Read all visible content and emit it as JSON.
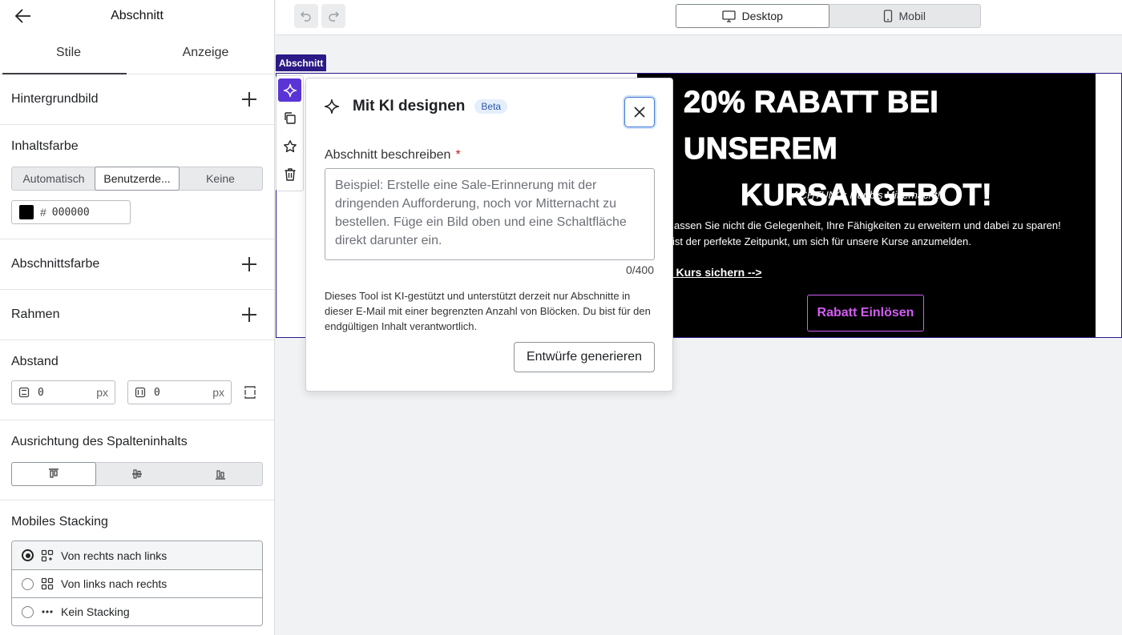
{
  "sidebar": {
    "title": "Abschnitt",
    "tabs": [
      {
        "label": "Stile",
        "active": true
      },
      {
        "label": "Anzeige",
        "active": false
      }
    ],
    "background_image": {
      "label": "Hintergrundbild"
    },
    "content_color": {
      "label": "Inhaltsfarbe",
      "options": [
        "Automatisch",
        "Benutzerde...",
        "Keine"
      ],
      "selected": "Benutzerde...",
      "hash": "#",
      "hex_value": "000000",
      "swatch_color": "#000000"
    },
    "section_color": {
      "label": "Abschnittsfarbe"
    },
    "border": {
      "label": "Rahmen"
    },
    "spacing": {
      "label": "Abstand",
      "vertical": {
        "value": "0",
        "unit": "px"
      },
      "horizontal": {
        "value": "0",
        "unit": "px"
      }
    },
    "column_alignment": {
      "label": "Ausrichtung des Spalteninhalts",
      "options": [
        "align-top",
        "align-middle",
        "align-bottom"
      ],
      "selected": "align-top"
    },
    "mobile_stacking": {
      "label": "Mobiles Stacking",
      "options": [
        {
          "label": "Von rechts nach links",
          "selected": true,
          "icon": "stack-right-left-icon"
        },
        {
          "label": "Von links nach rechts",
          "selected": false,
          "icon": "stack-left-right-icon"
        },
        {
          "label": "Kein Stacking",
          "selected": false,
          "icon": "dots-icon"
        }
      ]
    }
  },
  "topbar": {
    "undo_icon": "undo-icon",
    "redo_icon": "redo-icon",
    "view_options": [
      {
        "label": "Desktop",
        "active": true,
        "icon": "desktop-icon"
      },
      {
        "label": "Mobil",
        "active": false,
        "icon": "mobile-icon"
      }
    ]
  },
  "canvas": {
    "section_tag": "Abschnitt",
    "accent_color": "#2b1a86",
    "email": {
      "headline_line1": "20% RABATT BEI UNSEREM",
      "headline_line2": "KURSANGEBOT!",
      "attention": "ACHTUNG: Nur bis Mitternacht!",
      "body_line1": "assen Sie nicht die Gelegenheit, Ihre Fähigkeiten zu erweitern und dabei zu sparen!",
      "body_line2": "ist der perfekte Zeitpunkt, um sich für unsere Kurse anzumelden.",
      "link": ": Kurs sichern -->",
      "cta": "Rabatt Einlösen",
      "cta_color": "#d45cf5"
    }
  },
  "ai_dialog": {
    "title": "Mit KI designen",
    "badge": "Beta",
    "field_label": "Abschnitt beschreiben",
    "required_mark": "*",
    "placeholder": "Beispiel: Erstelle eine Sale-Erinnerung mit der dringenden Aufforderung, noch vor Mitternacht zu bestellen. Füge ein Bild oben und eine Schaltfläche direkt darunter ein.",
    "value": "",
    "counter": "0/400",
    "disclaimer": "Dieses Tool ist KI-gestützt und unterstützt derzeit nur Abschnitte in dieser E-Mail mit einer begrenzten Anzahl von Blöcken. Du bist für den endgültigen Inhalt verantwortlich.",
    "generate_button": "Entwürfe generieren"
  }
}
